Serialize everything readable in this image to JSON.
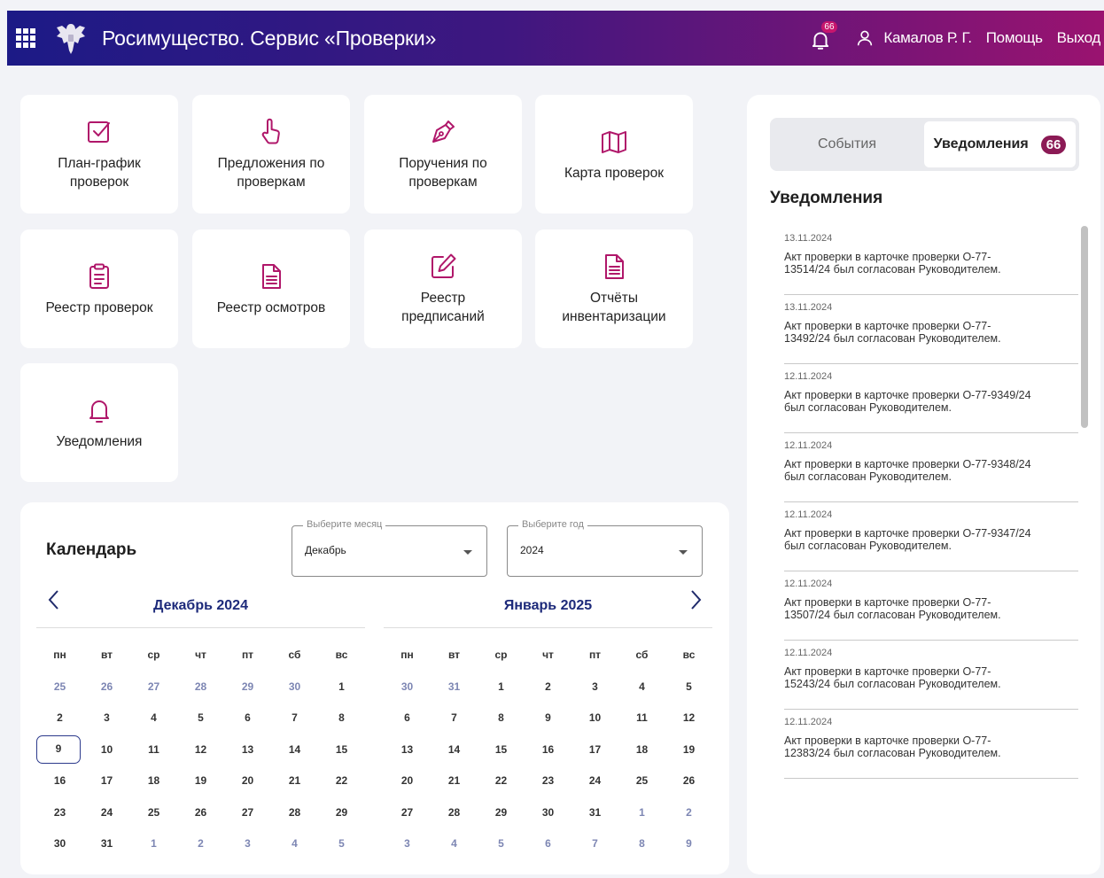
{
  "header": {
    "title": "Росимущество. Сервис «Проверки»",
    "bell_count": "66",
    "user_name": "Камалов Р. Г.",
    "help_label": "Помощь",
    "logout_label": "Выход",
    "gradient_colors": [
      "#1c1a86",
      "#3e1780",
      "#9a1370"
    ]
  },
  "tiles": [
    {
      "label": "План-график\nпроверок",
      "icon": "checkbox-icon"
    },
    {
      "label": "Предложения по\nпроверкам",
      "icon": "pointer-hand-icon"
    },
    {
      "label": "Поручения по\nпроверкам",
      "icon": "pen-nib-icon"
    },
    {
      "label": "Карта проверок",
      "icon": "map-icon"
    },
    {
      "label": "Реестр проверок",
      "icon": "clipboard-icon"
    },
    {
      "label": "Реестр осмотров",
      "icon": "document-icon"
    },
    {
      "label": "Реестр\nпредписаний",
      "icon": "edit-icon"
    },
    {
      "label": "Отчёты\nинвентаризации",
      "icon": "document-icon"
    },
    {
      "label": "Уведомления",
      "icon": "bell-icon"
    }
  ],
  "accent_color": "#b0176a",
  "calendar": {
    "title": "Календарь",
    "month_select": {
      "legend": "Выберите месяц",
      "value": "Декабрь"
    },
    "year_select": {
      "legend": "Выберите год",
      "value": "2024"
    },
    "weekdays": [
      "пн",
      "вт",
      "ср",
      "чт",
      "пт",
      "сб",
      "вс"
    ],
    "months": [
      {
        "title": "Декабрь 2024",
        "days": [
          [
            "25",
            "26",
            "27",
            "28",
            "29",
            "30",
            "1"
          ],
          [
            "2",
            "3",
            "4",
            "5",
            "6",
            "7",
            "8"
          ],
          [
            "9",
            "10",
            "11",
            "12",
            "13",
            "14",
            "15"
          ],
          [
            "16",
            "17",
            "18",
            "19",
            "20",
            "21",
            "22"
          ],
          [
            "23",
            "24",
            "25",
            "26",
            "27",
            "28",
            "29"
          ],
          [
            "30",
            "31",
            "1",
            "2",
            "3",
            "4",
            "5"
          ]
        ],
        "out": [
          [
            0,
            0
          ],
          [
            0,
            1
          ],
          [
            0,
            2
          ],
          [
            0,
            3
          ],
          [
            0,
            4
          ],
          [
            0,
            5
          ],
          [
            5,
            2
          ],
          [
            5,
            3
          ],
          [
            5,
            4
          ],
          [
            5,
            5
          ],
          [
            5,
            6
          ]
        ],
        "today": [
          2,
          0
        ]
      },
      {
        "title": "Январь 2025",
        "days": [
          [
            "30",
            "31",
            "1",
            "2",
            "3",
            "4",
            "5"
          ],
          [
            "6",
            "7",
            "8",
            "9",
            "10",
            "11",
            "12"
          ],
          [
            "13",
            "14",
            "15",
            "16",
            "17",
            "18",
            "19"
          ],
          [
            "20",
            "21",
            "22",
            "23",
            "24",
            "25",
            "26"
          ],
          [
            "27",
            "28",
            "29",
            "30",
            "31",
            "1",
            "2"
          ],
          [
            "3",
            "4",
            "5",
            "6",
            "7",
            "8",
            "9"
          ]
        ],
        "out": [
          [
            0,
            0
          ],
          [
            0,
            1
          ],
          [
            4,
            5
          ],
          [
            4,
            6
          ],
          [
            5,
            0
          ],
          [
            5,
            1
          ],
          [
            5,
            2
          ],
          [
            5,
            3
          ],
          [
            5,
            4
          ],
          [
            5,
            5
          ],
          [
            5,
            6
          ]
        ],
        "today": null
      }
    ]
  },
  "side": {
    "tab_events": "События",
    "tab_notifications": "Уведомления",
    "tab_count": "66",
    "title": "Уведомления",
    "notifications": [
      {
        "date": "13.11.2024",
        "text": "Акт проверки в карточке проверки О-77-\n13514/24 был согласован Руководителем."
      },
      {
        "date": "13.11.2024",
        "text": "Акт проверки в карточке проверки О-77-\n13492/24 был согласован Руководителем."
      },
      {
        "date": "12.11.2024",
        "text": "Акт проверки в карточке проверки О-77-9349/24\nбыл согласован Руководителем."
      },
      {
        "date": "12.11.2024",
        "text": "Акт проверки в карточке проверки О-77-9348/24\nбыл согласован Руководителем."
      },
      {
        "date": "12.11.2024",
        "text": "Акт проверки в карточке проверки О-77-9347/24\nбыл согласован Руководителем."
      },
      {
        "date": "12.11.2024",
        "text": "Акт проверки в карточке проверки О-77-\n13507/24 был согласован Руководителем."
      },
      {
        "date": "12.11.2024",
        "text": "Акт проверки в карточке проверки О-77-\n15243/24 был согласован Руководителем."
      },
      {
        "date": "12.11.2024",
        "text": "Акт проверки в карточке проверки О-77-\n12383/24 был согласован Руководителем."
      }
    ]
  }
}
